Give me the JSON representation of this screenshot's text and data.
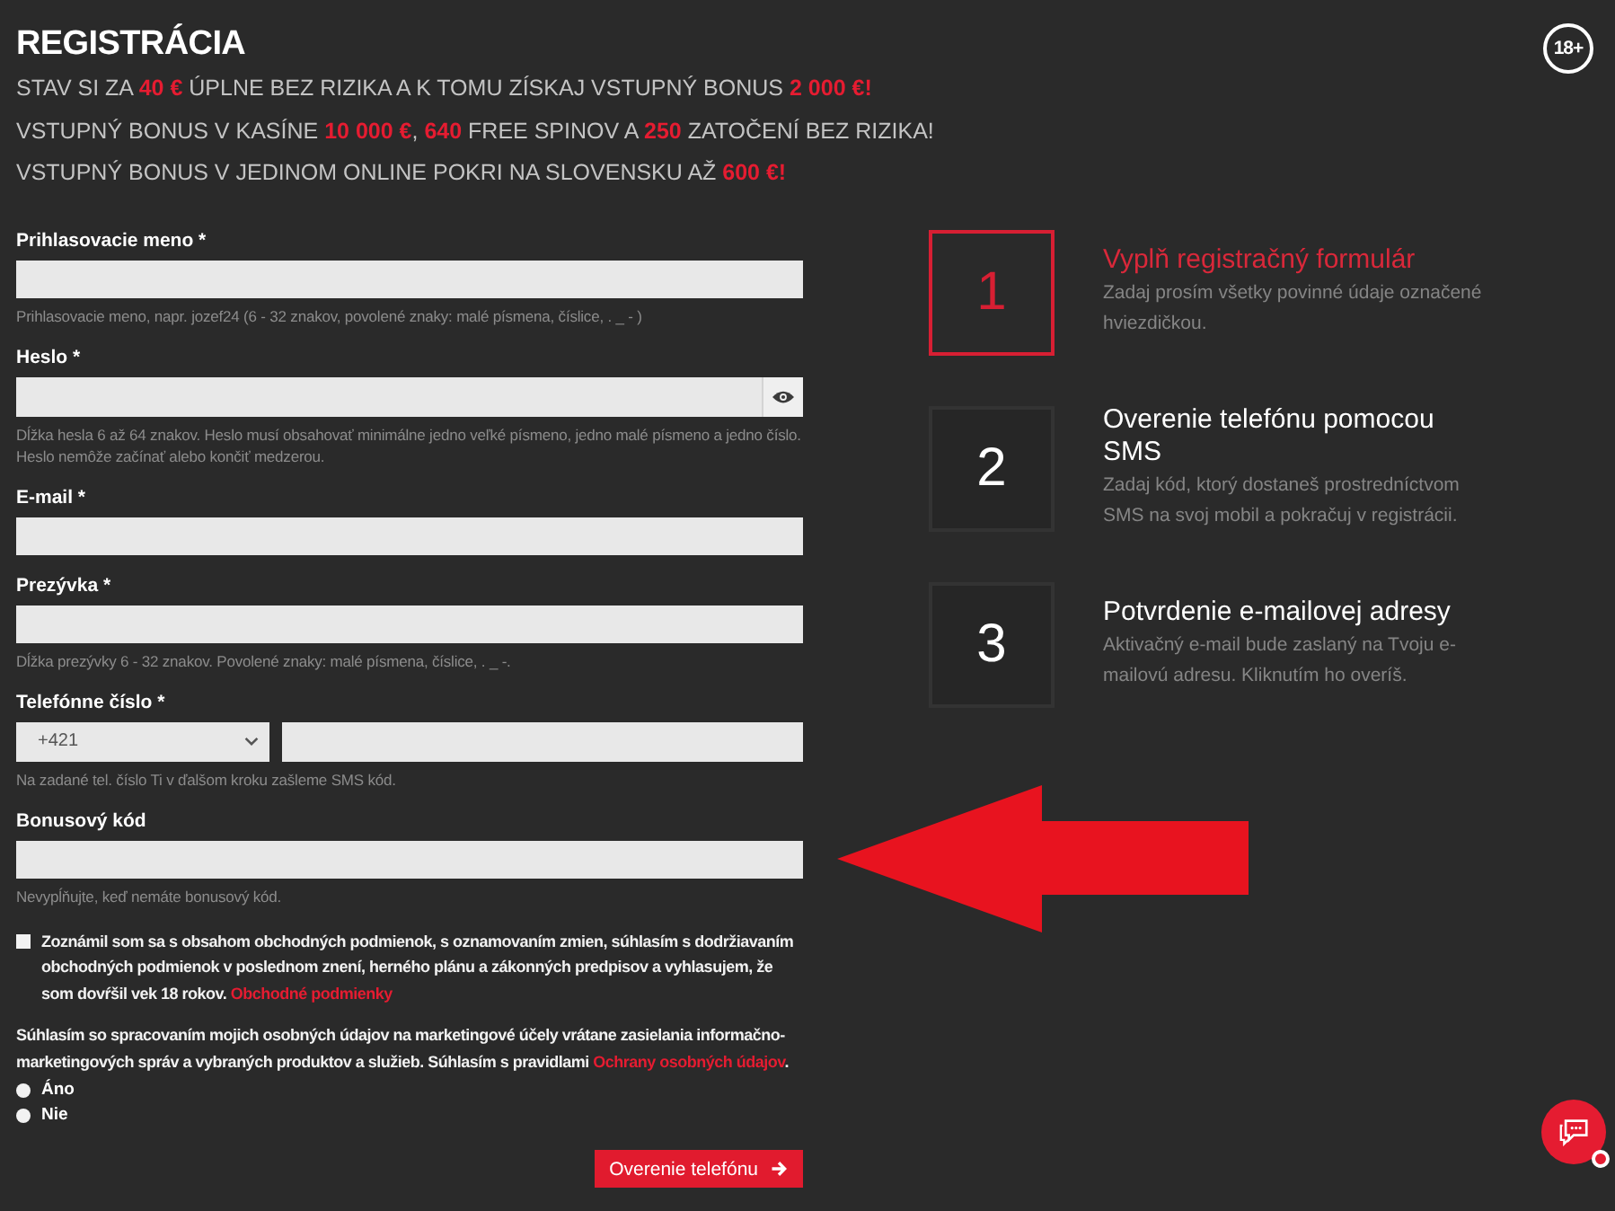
{
  "header": {
    "title": "REGISTRÁCIA",
    "promo_lines": [
      "STAV SI ZA **40 €** ÚPLNE BEZ RIZIKA A K TOMU ZÍSKAJ VSTUPNÝ BONUS **2 000 €!**",
      "VSTUPNÝ BONUS V KASÍNE **10 000 €**, **640** FREE SPINOV A **250** ZATOČENÍ BEZ RIZIKA!",
      "VSTUPNÝ BONUS V JEDINOM ONLINE POKRI NA SLOVENSKU AŽ **600 €!**"
    ]
  },
  "age_badge": {
    "label": "18+"
  },
  "form": {
    "fields": [
      {
        "kind": "text",
        "label": "Prihlasovacie meno *",
        "hint": "Prihlasovacie meno, napr. jozef24 (6 - 32 znakov, povolené znaky: malé písmena, číslice, . _ - )"
      },
      {
        "kind": "password",
        "label": "Heslo *",
        "hint": "Dĺžka hesla 6 až 64 znakov. Heslo musí obsahovať minimálne jedno veľké písmeno, jedno malé písmeno a jedno číslo. Heslo nemôže začínať alebo končiť medzerou."
      },
      {
        "kind": "text",
        "label": "E-mail *"
      },
      {
        "kind": "text",
        "label": "Prezývka *",
        "hint": "Dĺžka prezývky 6 - 32 znakov. Povolené znaky: malé písmena, číslice, . _ -."
      },
      {
        "kind": "phone",
        "label": "Telefónne číslo *",
        "prefix": "+421",
        "hint": "Na zadané tel. číslo Ti v ďalšom kroku zašleme SMS kód."
      },
      {
        "kind": "text",
        "label": "Bonusový kód",
        "hint": "Nevypĺňujte, keď nemáte bonusový kód."
      }
    ],
    "terms": {
      "checked": false,
      "text": "Zoznámil som sa s obsahom obchodných podmienok, s oznamovaním zmien, súhlasím s dodržiavaním obchodných podmienok v poslednom znení, herného plánu a zákonných predpisov a vyhlasujem, že som dovŕšil vek 18 rokov.",
      "link": "Obchodné podmienky"
    },
    "consent": {
      "text": "Súhlasím so spracovaním mojich osobných údajov na marketingové účely vrátane zasielania informačno-marketingových správ a vybraných produktov a služieb. Súhlasím s pravidlami",
      "link": "Ochrany osobných údajov",
      "suffix": "."
    },
    "options": [
      {
        "label": "Áno",
        "selected": false
      },
      {
        "label": "Nie",
        "selected": false
      }
    ],
    "submit": {
      "label": "Overenie telefónu"
    }
  },
  "steps": [
    {
      "number": "1",
      "title": "Vyplň registračný formulár",
      "description": "Zadaj prosím všetky povinné údaje označené hviezdičkou.",
      "active": true
    },
    {
      "number": "2",
      "title": "Overenie telefónu pomocou SMS",
      "description": "Zadaj kód, ktorý dostaneš prostredníctvom SMS na svoj mobil a pokračuj v registrácii.",
      "active": false
    },
    {
      "number": "3",
      "title": "Potvrdenie e-mailovej adresy",
      "description": "Aktivačný e-mail bude zaslaný na Tvoju e-mailovú adresu. Kliknutím ho overíš.",
      "active": false
    }
  ]
}
